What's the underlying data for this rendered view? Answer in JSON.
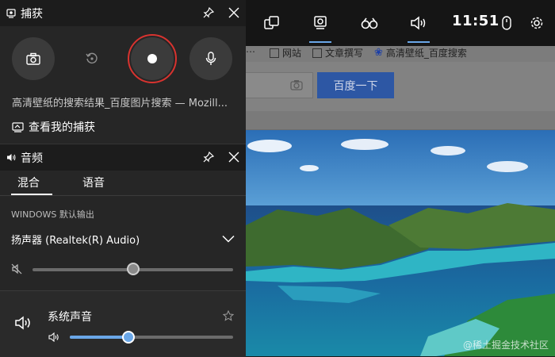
{
  "capture": {
    "title": "捕获",
    "source": "高清壁纸的搜索结果_百度图片搜索 — Mozill...",
    "view_captures": "查看我的捕获"
  },
  "audio": {
    "title": "音频",
    "tabs": [
      "混合",
      "语音"
    ],
    "active_tab": "混合",
    "output_label": "WINDOWS 默认输出",
    "device": "扬声器 (Realtek(R) Audio)",
    "master_level": 0.5,
    "app_name": "系统声音",
    "app_level": 0.36
  },
  "topbar": {
    "clock": "11:51"
  },
  "browser": {
    "bookmarks": [
      "网站",
      "文章撰写",
      "高清壁纸_百度搜索"
    ],
    "search_button": "百度一下",
    "watermark": "@稀土掘金技术社区"
  },
  "colors": {
    "accent": "#6aa7e8",
    "record_ring": "#d8332f"
  }
}
